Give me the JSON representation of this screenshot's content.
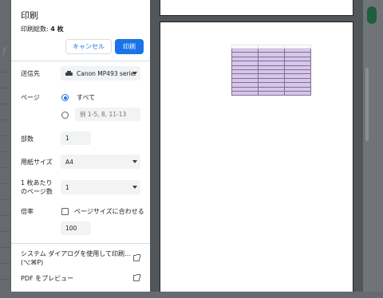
{
  "dialog": {
    "title": "印刷",
    "total_label": "印刷総数: ",
    "total_value": "4 枚",
    "cancel_label": "キャンセル",
    "print_label": "印刷"
  },
  "destination": {
    "label": "送信先",
    "value": "Canon MP493 series",
    "icon": "printer-icon"
  },
  "pages": {
    "label": "ページ",
    "all_label": "すべて",
    "custom_placeholder": "例 1-5, 8, 11-13",
    "selected": "all"
  },
  "copies": {
    "label": "部数",
    "value": "1"
  },
  "paper_size": {
    "label": "用紙サイズ",
    "value": "A4"
  },
  "pages_per_sheet": {
    "label_line1": "1 枚あたり",
    "label_line2": "のページ数",
    "value": "1"
  },
  "scale": {
    "label": "倍率",
    "fit_label": "ページサイズに合わせる",
    "fit_checked": false,
    "value": "100"
  },
  "links": {
    "system_dialog": "システム ダイアログを使用して印刷...",
    "system_shortcut": "(⌥⌘P)",
    "pdf_preview": "PDF をプレビュー"
  },
  "colors": {
    "accent": "#1a73e8",
    "highlight": "#d7c6e8"
  }
}
